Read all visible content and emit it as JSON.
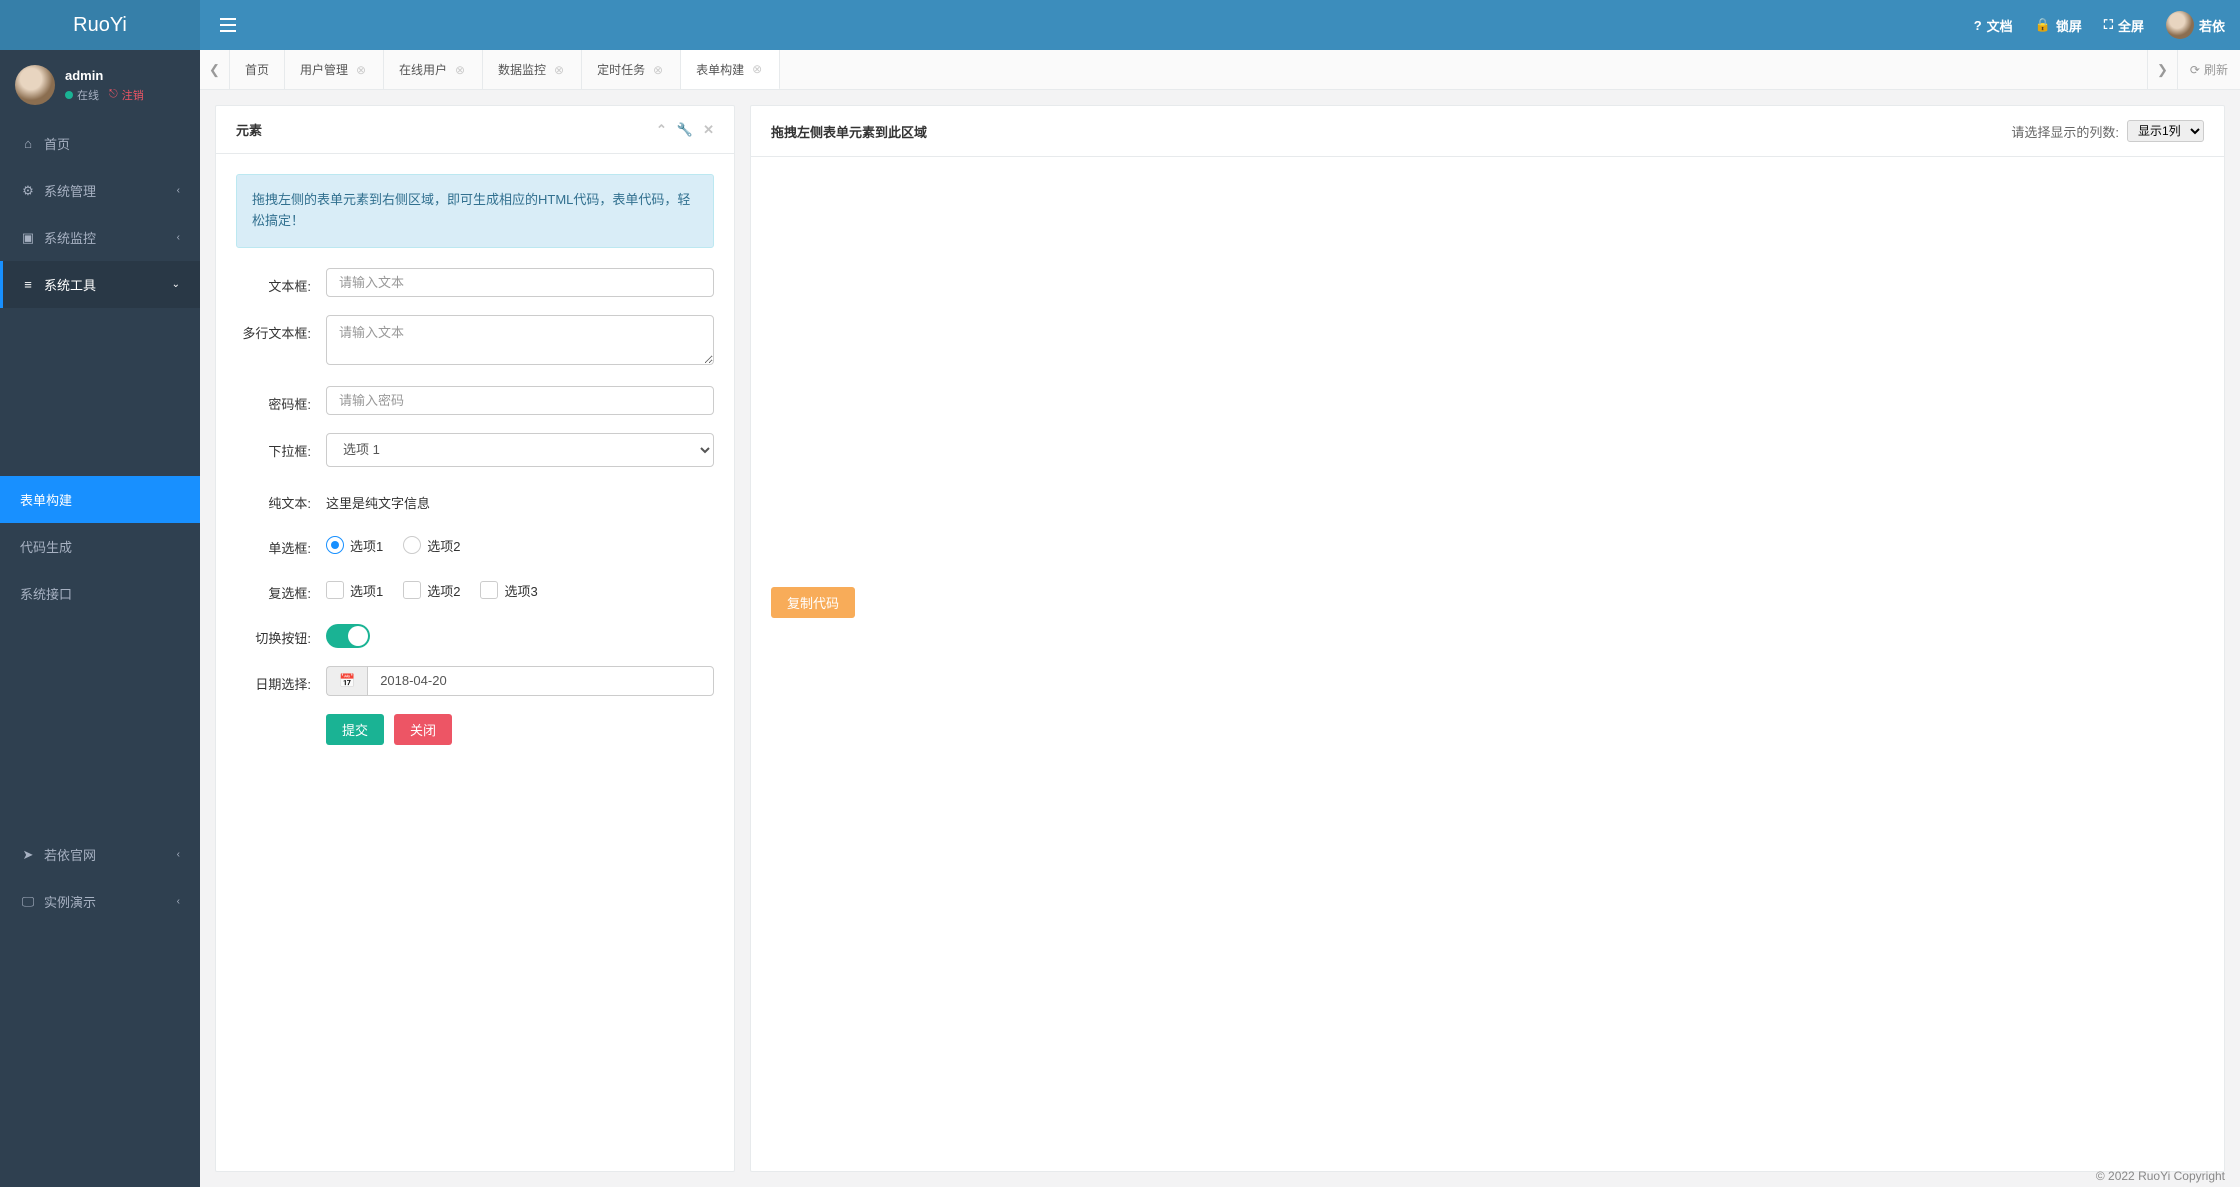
{
  "brand": "RuoYi",
  "user": {
    "name": "admin",
    "status": "在线",
    "logout": "注销"
  },
  "nav": {
    "home": "首页",
    "sys_mgmt": "系统管理",
    "sys_mon": "系统监控",
    "sys_tools": "系统工具",
    "form_build": "表单构建",
    "code_gen": "代码生成",
    "api": "系统接口",
    "official": "若依官网",
    "demo": "实例演示"
  },
  "top": {
    "doc": "文档",
    "lock": "锁屏",
    "full": "全屏",
    "username": "若依"
  },
  "tabs": {
    "home": "首页",
    "user_mgmt": "用户管理",
    "online": "在线用户",
    "data_mon": "数据监控",
    "timed": "定时任务",
    "form_build": "表单构建",
    "refresh": "刷新"
  },
  "leftPanel": {
    "title": "元素",
    "alert": "拖拽左侧的表单元素到右侧区域，即可生成相应的HTML代码，表单代码，轻松搞定！",
    "fields": {
      "text_label": "文本框:",
      "text_ph": "请输入文本",
      "textarea_label": "多行文本框:",
      "textarea_ph": "请输入文本",
      "pwd_label": "密码框:",
      "pwd_ph": "请输入密码",
      "select_label": "下拉框:",
      "select_opt1": "选项 1",
      "static_label": "纯文本:",
      "static_text": "这里是纯文字信息",
      "radio_label": "单选框:",
      "radio1": "选项1",
      "radio2": "选项2",
      "check_label": "复选框:",
      "check1": "选项1",
      "check2": "选项2",
      "check3": "选项3",
      "switch_label": "切换按钮:",
      "date_label": "日期选择:",
      "date_val": "2018-04-20",
      "submit": "提交",
      "close": "关闭"
    }
  },
  "rightPanel": {
    "title": "拖拽左侧表单元素到此区域",
    "select_label": "请选择显示的列数:",
    "select_opt": "显示1列",
    "copy_btn": "复制代码"
  },
  "footer": "© 2022 RuoYi Copyright"
}
